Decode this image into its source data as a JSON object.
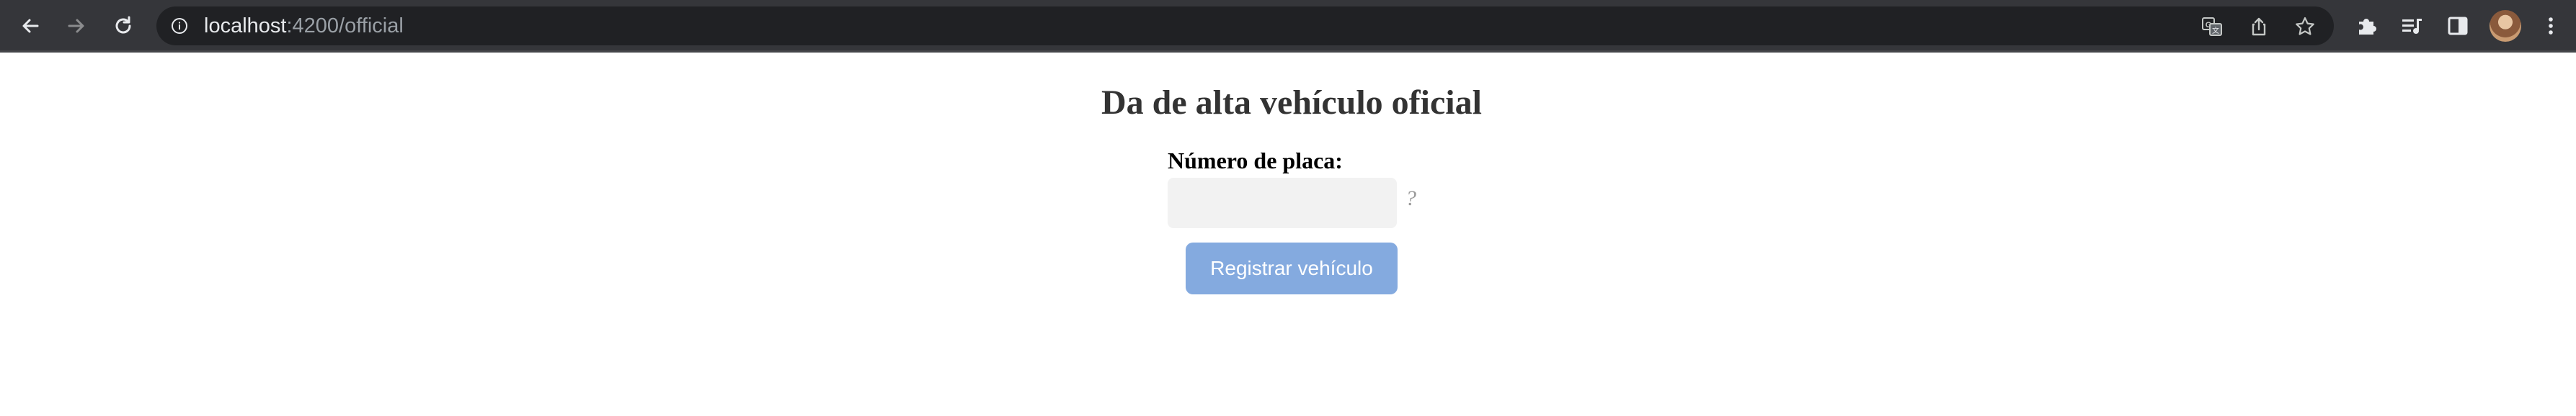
{
  "browser": {
    "url_host": "localhost",
    "url_path": ":4200/official",
    "icons": {
      "back": "arrow-left-icon",
      "forward": "arrow-right-icon",
      "reload": "reload-icon",
      "info": "info-icon",
      "translate": "translate-icon",
      "share": "share-icon",
      "bookmark": "star-icon",
      "extensions": "puzzle-icon",
      "reading_list": "reading-list-icon",
      "side_panel": "side-panel-icon",
      "profile": "avatar",
      "menu": "kebab-menu-icon"
    }
  },
  "form": {
    "title": "Da de alta vehículo oficial",
    "plate_label": "Número de placa:",
    "plate_value": "",
    "help": "?",
    "submit_label": "Registrar vehículo",
    "submit_color": "#84aadf"
  }
}
